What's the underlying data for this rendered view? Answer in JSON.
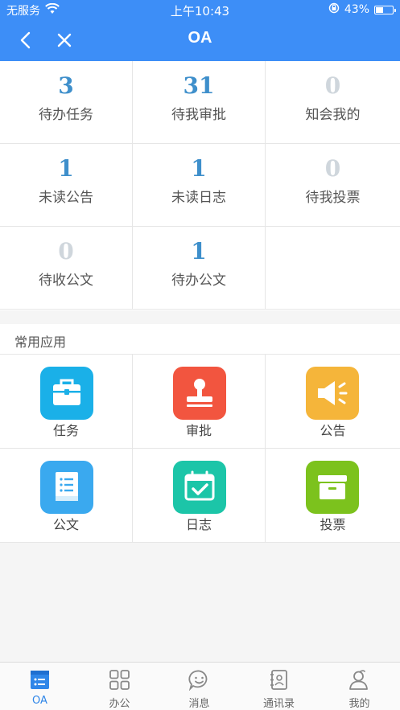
{
  "status_bar": {
    "carrier": "无服务",
    "time": "上午10:43",
    "battery": "43%",
    "battery_level": 0.43
  },
  "nav": {
    "title": "OA"
  },
  "stats": [
    {
      "value": "3",
      "label": "待办任务"
    },
    {
      "value": "31",
      "label": "待我审批"
    },
    {
      "value": "0",
      "label": "知会我的"
    },
    {
      "value": "1",
      "label": "未读公告"
    },
    {
      "value": "1",
      "label": "未读日志"
    },
    {
      "value": "0",
      "label": "待我投票"
    },
    {
      "value": "0",
      "label": "待收公文"
    },
    {
      "value": "1",
      "label": "待办公文"
    }
  ],
  "section": {
    "title": "常用应用"
  },
  "apps": [
    {
      "label": "任务",
      "icon": "briefcase-icon",
      "color": "#1ab0e8"
    },
    {
      "label": "审批",
      "icon": "stamp-icon",
      "color": "#f2553f"
    },
    {
      "label": "公告",
      "icon": "megaphone-icon",
      "color": "#f5b53a"
    },
    {
      "label": "公文",
      "icon": "document-icon",
      "color": "#3aa9ef"
    },
    {
      "label": "日志",
      "icon": "calendar-check-icon",
      "color": "#1cc5a8"
    },
    {
      "label": "投票",
      "icon": "ballot-box-icon",
      "color": "#7cc21d"
    }
  ],
  "tabs": [
    {
      "label": "OA",
      "icon": "oa-list-icon",
      "active": true
    },
    {
      "label": "办公",
      "icon": "grid-icon",
      "active": false
    },
    {
      "label": "消息",
      "icon": "chat-smile-icon",
      "active": false
    },
    {
      "label": "通讯录",
      "icon": "contacts-book-icon",
      "active": false
    },
    {
      "label": "我的",
      "icon": "person-icon",
      "active": false
    }
  ],
  "colors": {
    "primary": "#3d8ef7",
    "stat_number": "#3e8fcb",
    "stat_zero": "#cfd6dc",
    "tab_active": "#2f86e8"
  }
}
